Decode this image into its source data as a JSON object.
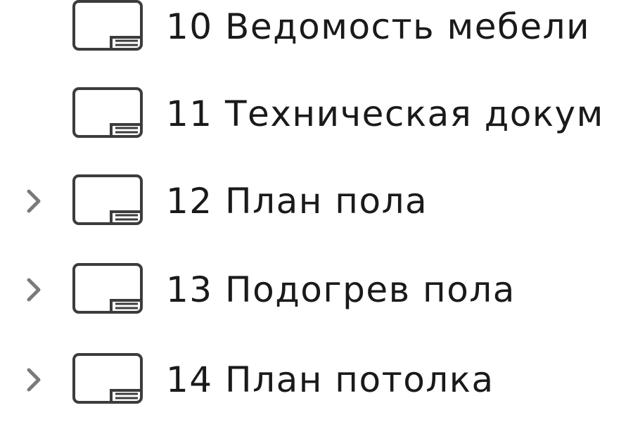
{
  "tree": {
    "items": [
      {
        "label": "10 Ведомость мебели",
        "expandable": false,
        "icon": "layout-sheet-icon"
      },
      {
        "label": "11 Техническая докум",
        "expandable": false,
        "icon": "layout-sheet-icon"
      },
      {
        "label": "12 План пола",
        "expandable": true,
        "icon": "layout-sheet-icon"
      },
      {
        "label": "13 Подогрев пола",
        "expandable": true,
        "icon": "layout-sheet-icon"
      },
      {
        "label": "14 План потолка",
        "expandable": true,
        "icon": "layout-sheet-icon"
      }
    ]
  },
  "colors": {
    "text": "#1a1a1a",
    "icon_stroke": "#3c3c3c",
    "chevron": "#7a7a7a",
    "background": "#ffffff"
  }
}
